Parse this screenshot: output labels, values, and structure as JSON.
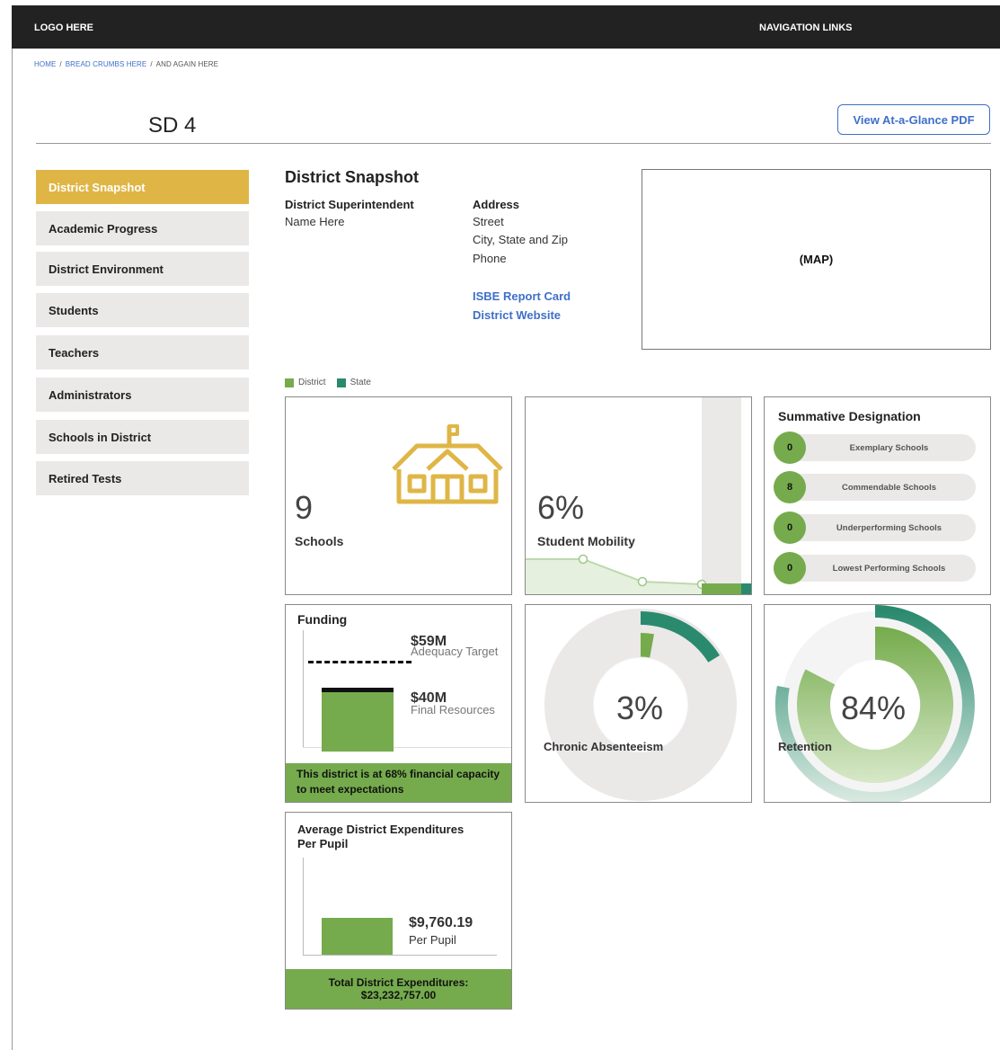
{
  "header": {
    "logo": "LOGO HERE",
    "nav": "NAVIGATION LINKS"
  },
  "breadcrumb": {
    "home": "HOME",
    "crumb": "BREAD CRUMBS HERE",
    "current": "AND AGAIN HERE",
    "separator": "/"
  },
  "district": {
    "name": "SD 4",
    "pdf_button": "View At-a-Glance PDF"
  },
  "sidebar": {
    "items": [
      {
        "label": "District Snapshot",
        "active": true
      },
      {
        "label": "Academic Progress",
        "active": false
      },
      {
        "label": "District Environment",
        "active": false
      },
      {
        "label": "Students",
        "active": false
      },
      {
        "label": "Teachers",
        "active": false
      },
      {
        "label": "Administrators",
        "active": false
      },
      {
        "label": "Schools in District",
        "active": false
      },
      {
        "label": "Retired Tests",
        "active": false
      }
    ]
  },
  "snapshot": {
    "title": "District Snapshot",
    "superintendent_label": "District Superintendent",
    "superintendent_name": "Name Here",
    "address_label": "Address",
    "street": "Street",
    "city": "City, State and Zip",
    "phone": "Phone",
    "report_card_link": "ISBE Report Card",
    "website_link": "District Website",
    "map": "(MAP)"
  },
  "legend": {
    "district": "District",
    "state": "State"
  },
  "cards": {
    "schools": {
      "value": "9",
      "label": "Schools",
      "icon": "school-building-icon"
    },
    "mobility": {
      "value": "6%",
      "label": "Student Mobility"
    },
    "summative": {
      "title": "Summative Designation",
      "rows": [
        {
          "count": "0",
          "label": "Exemplary Schools"
        },
        {
          "count": "8",
          "label": "Commendable Schools"
        },
        {
          "count": "0",
          "label": "Underperforming Schools"
        },
        {
          "count": "0",
          "label": "Lowest Performing Schools"
        }
      ]
    },
    "funding": {
      "title": "Funding",
      "target_value": "$59M",
      "target_label": "Adequacy Target",
      "final_value": "$40M",
      "final_label": "Final Resources",
      "footer": "This district is at 68% financial capacity to meet expectations"
    },
    "absenteeism": {
      "value": "3%",
      "label": "Chronic Absenteeism",
      "fraction": 0.03
    },
    "retention": {
      "value": "84%",
      "label": "Retention",
      "fraction": 0.84
    },
    "expenditures": {
      "title_line1": "Average District Expenditures",
      "title_line2": "Per Pupil",
      "value": "$9,760.19",
      "value_label": "Per Pupil",
      "footer_line1": "Total District Expenditures:",
      "footer_line2": "$23,232,757.00"
    }
  },
  "colors": {
    "gold": "#dfb646",
    "district_green": "#75ab4c",
    "state_teal": "#2a8a6e",
    "link_blue": "#3f6fc9",
    "nav_gray": "#ebe8e8",
    "topbar": "#222222"
  }
}
